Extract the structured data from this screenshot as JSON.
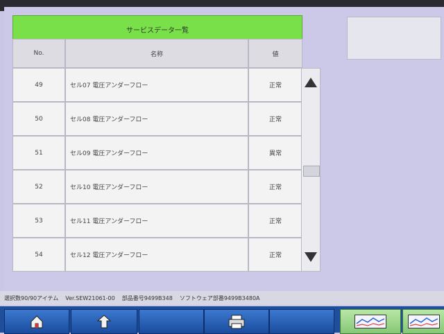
{
  "table": {
    "title": "サービスデータ一覧",
    "headers": [
      "No.",
      "名称",
      "値"
    ],
    "rows": [
      {
        "no": "49",
        "name": "セル07 電圧アンダーフロー",
        "value": "正常"
      },
      {
        "no": "50",
        "name": "セル08 電圧アンダーフロー",
        "value": "正常"
      },
      {
        "no": "51",
        "name": "セル09 電圧アンダーフロー",
        "value": "異常"
      },
      {
        "no": "52",
        "name": "セル10 電圧アンダーフロー",
        "value": "正常"
      },
      {
        "no": "53",
        "name": "セル11 電圧アンダーフロー",
        "value": "正常"
      },
      {
        "no": "54",
        "name": "セル12 電圧アンダーフロー",
        "value": "正常"
      }
    ]
  },
  "status": {
    "selected": "選択数90/90アイテム",
    "version": "Ver.SEW21061-00",
    "part": "部品番号9499B348",
    "software": "ソフトウェア部番9499B3480A"
  },
  "toolbar": {
    "icons": [
      "home-icon",
      "back-arrow-icon",
      "printer-icon",
      "graph-icon",
      "graph-icon"
    ]
  },
  "colors": {
    "title_green": "#79e04a",
    "toolbar_blue": "#1f4f9a",
    "background": "#cbc8e8"
  }
}
